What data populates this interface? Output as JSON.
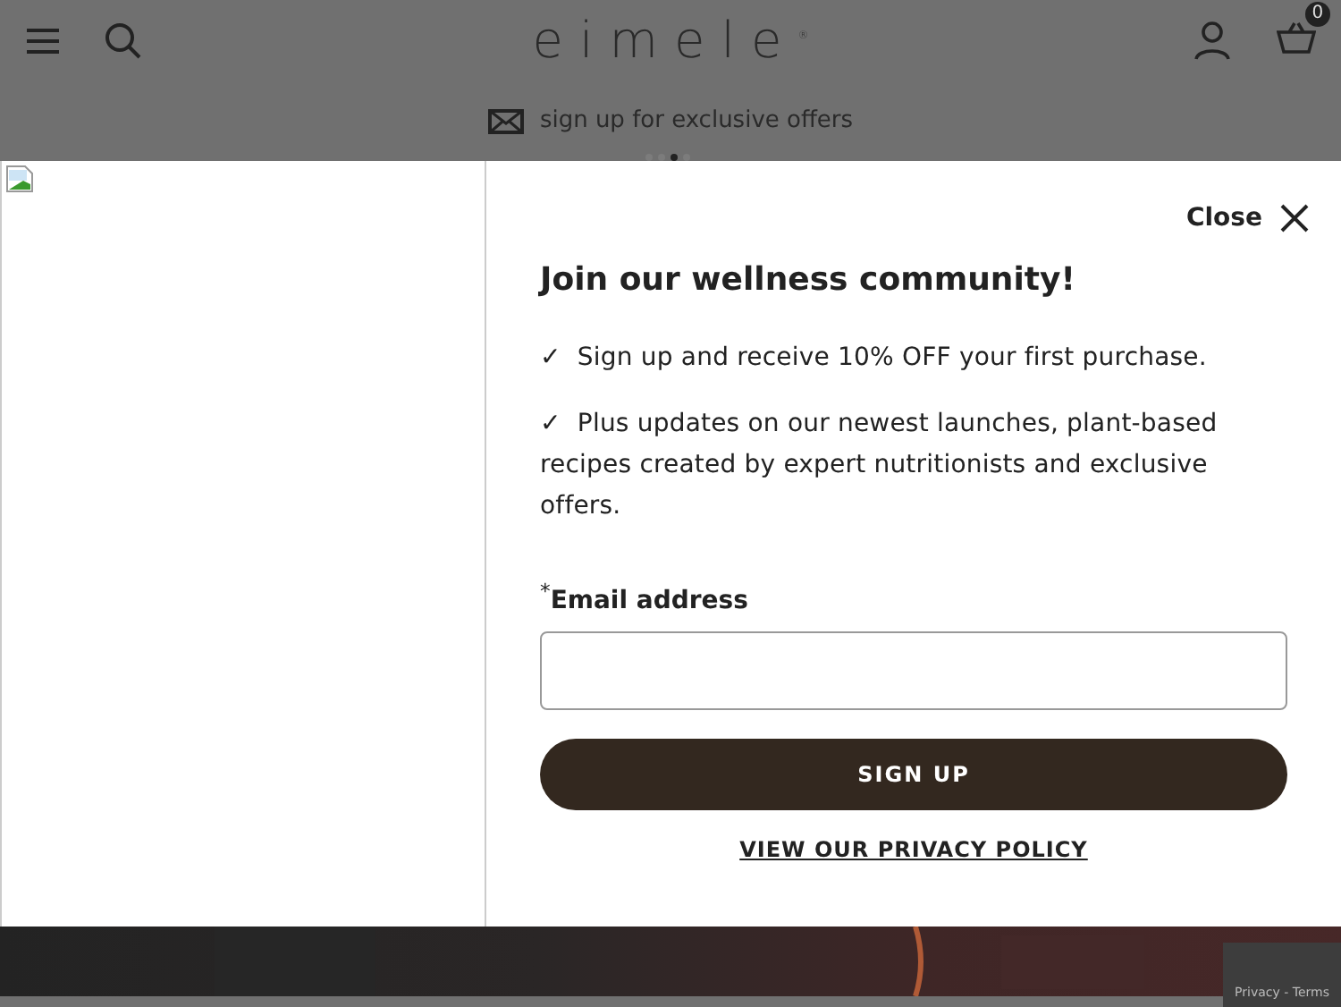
{
  "header": {
    "logo": "eimele",
    "logo_mark": "®",
    "bag_count": "0"
  },
  "banner": {
    "text": "sign up for exclusive offers",
    "dots": [
      {
        "selected": false
      },
      {
        "selected": false
      },
      {
        "selected": true
      },
      {
        "selected": false
      }
    ]
  },
  "modal": {
    "close_label": "Close",
    "title": "Join our wellness community!",
    "benefits": [
      {
        "check": "✓",
        "text": "Sign up and receive 10% OFF your first purchase."
      },
      {
        "check": "✓",
        "text": "Plus updates on our newest launches, plant-based recipes created by expert nutritionists and exclusive offers."
      }
    ],
    "email_label": "$^{*}$**Email address**",
    "submit": "SIGN UP",
    "privacy_link": "VIEW OUR PRIVACY POLICY"
  },
  "recaptcha": {
    "text": "Privacy - Terms"
  }
}
